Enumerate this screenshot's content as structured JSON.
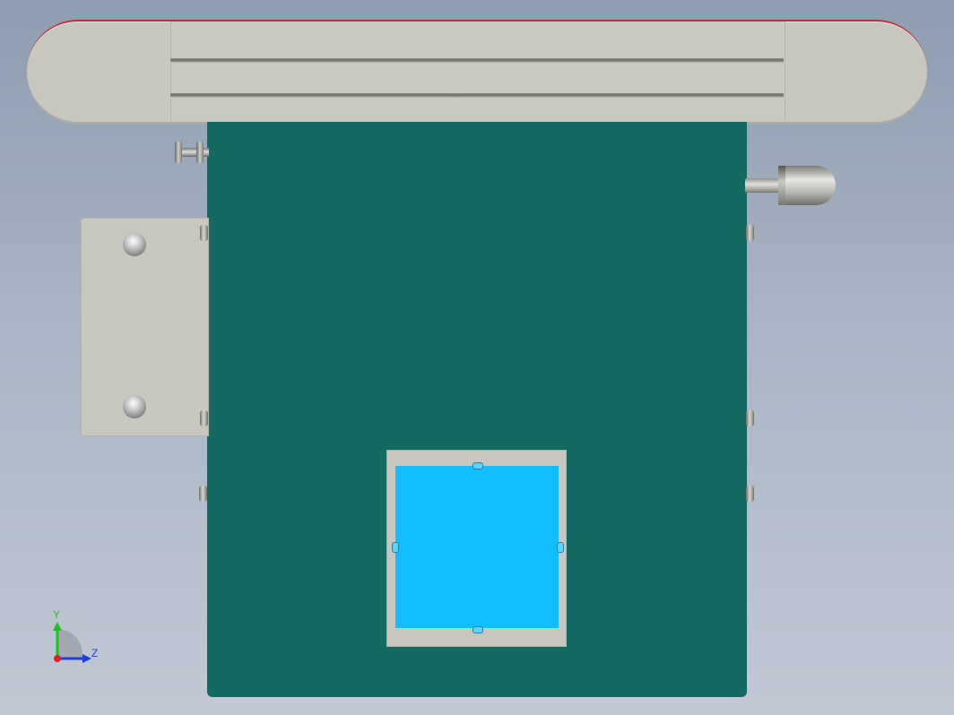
{
  "viewport": {
    "background_gradient": [
      "#8f9db1",
      "#c2c8d4"
    ]
  },
  "model": {
    "colors": {
      "plate": "#136a63",
      "belt": "#c9c8c0",
      "belt_edge": "#c0303a",
      "window": "#12bdfe",
      "frame": "#c9c7c0"
    }
  },
  "triad": {
    "y_label": "Y",
    "z_label": "Z",
    "colors": {
      "y": "#1ec21e",
      "z": "#1b3fe0",
      "x_dot": "#e02020"
    }
  }
}
